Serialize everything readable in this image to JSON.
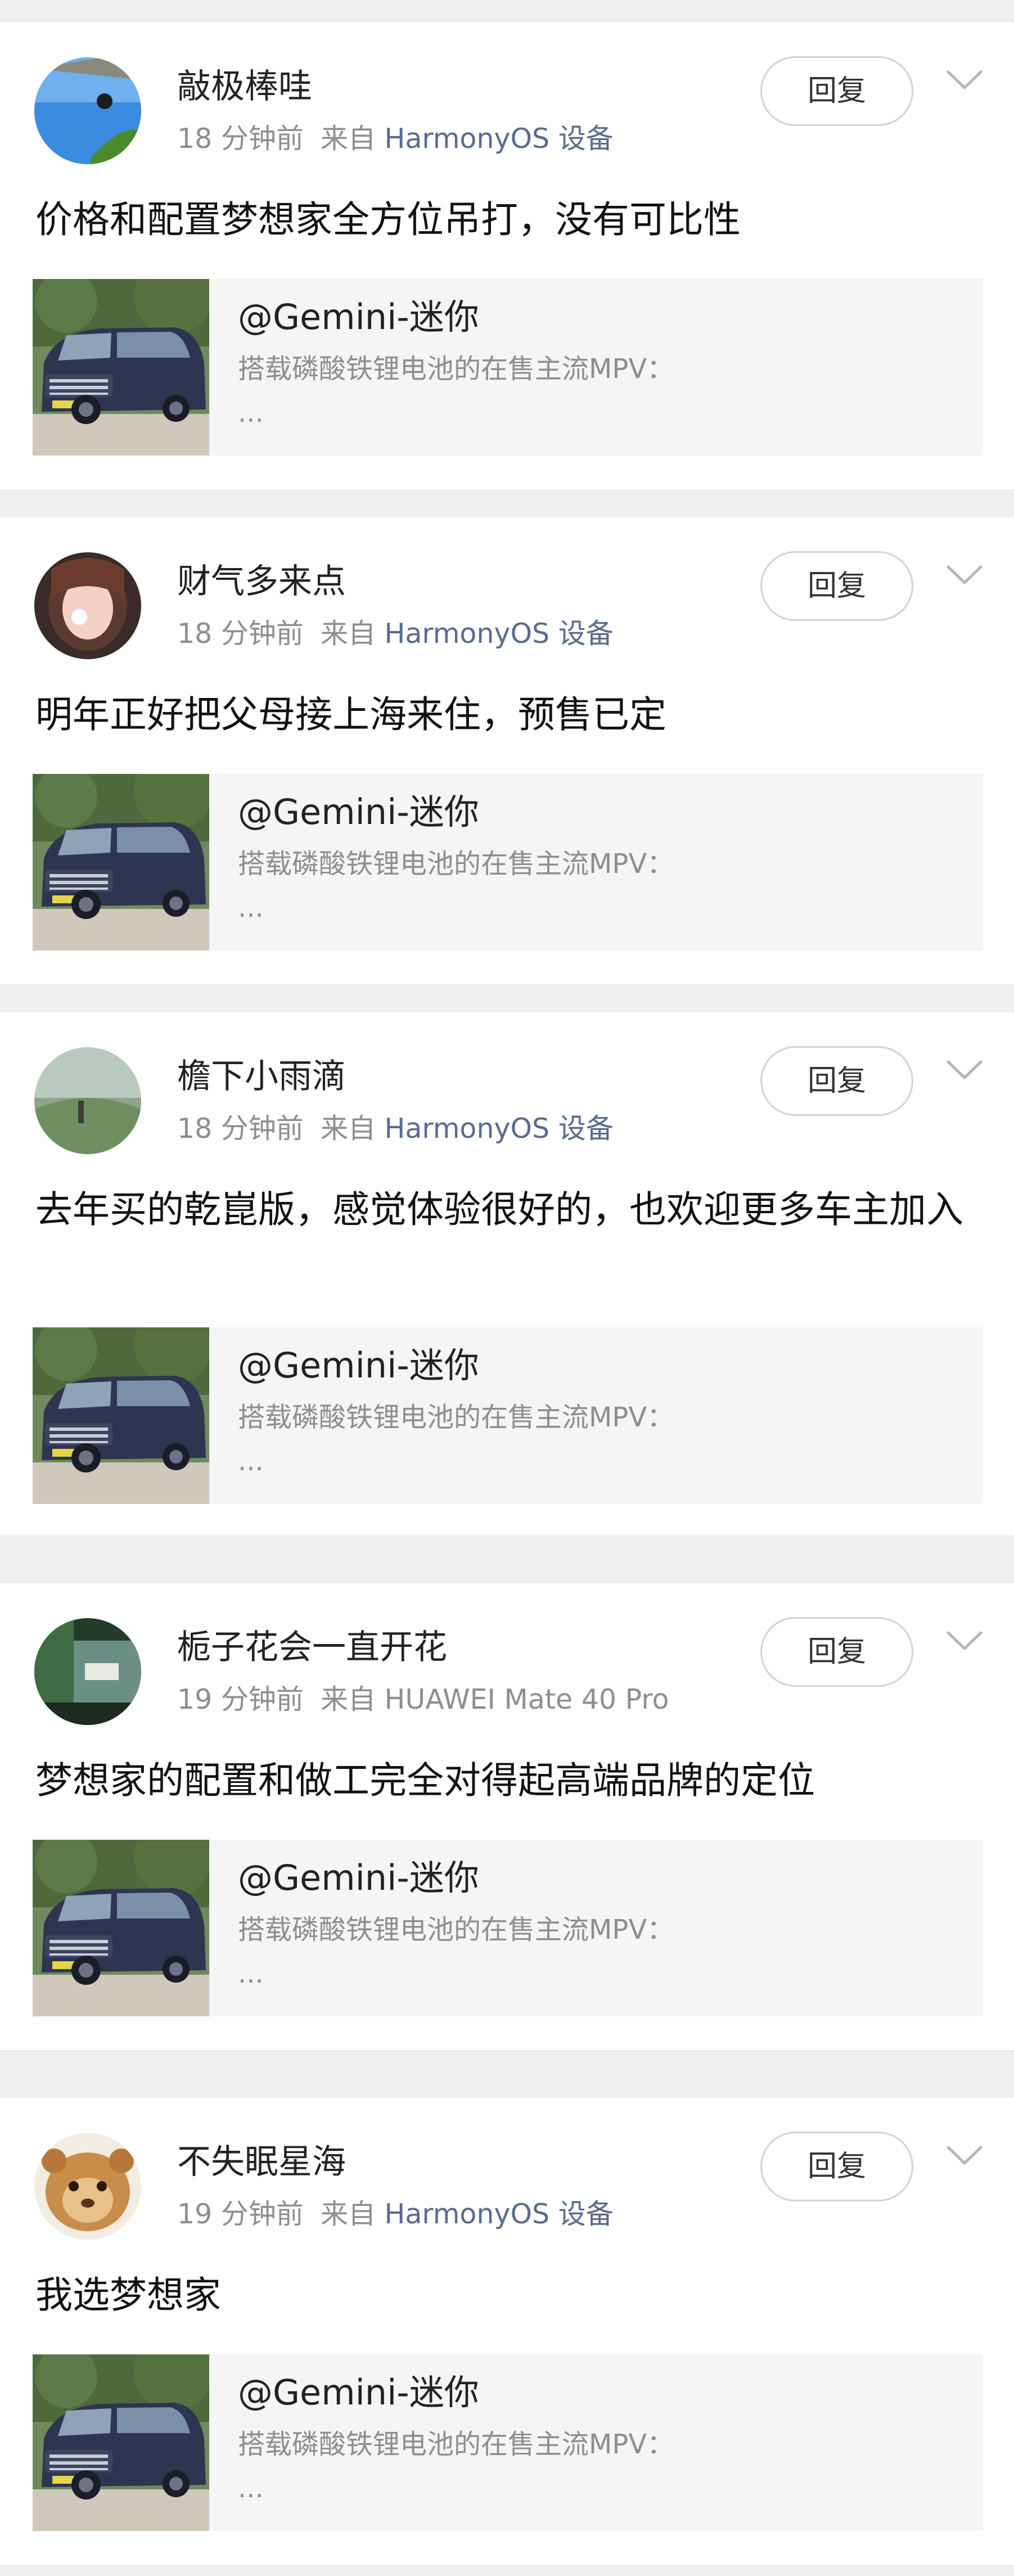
{
  "comments": [
    {
      "username": "敲极棒哇",
      "time": "18 分钟前",
      "source_prefix": "来自",
      "device": "HarmonyOS 设备",
      "reply_label": "回复",
      "text": "价格和配置梦想家全方位吊打，没有可比性",
      "quote": {
        "title": "@Gemini-迷你",
        "desc": "搭载磷酸铁锂电池的在售主流MPV：",
        "more": "..."
      }
    },
    {
      "username": "财气多来点",
      "time": "18 分钟前",
      "source_prefix": "来自",
      "device": "HarmonyOS 设备",
      "reply_label": "回复",
      "text": "明年正好把父母接上海来住，预售已定",
      "quote": {
        "title": "@Gemini-迷你",
        "desc": "搭载磷酸铁锂电池的在售主流MPV：",
        "more": "..."
      }
    },
    {
      "username": "檐下小雨滴",
      "time": "18 分钟前",
      "source_prefix": "来自",
      "device": "HarmonyOS 设备",
      "reply_label": "回复",
      "text": "去年买的乾崑版，感觉体验很好的，也欢迎更多车主加入",
      "quote": {
        "title": "@Gemini-迷你",
        "desc": "搭载磷酸铁锂电池的在售主流MPV：",
        "more": "..."
      }
    },
    {
      "username": "栀子花会一直开花",
      "time": "19 分钟前",
      "source_prefix": "来自",
      "device": "HUAWEI Mate 40 Pro",
      "reply_label": "回复",
      "text": "梦想家的配置和做工完全对得起高端品牌的定位",
      "quote": {
        "title": "@Gemini-迷你",
        "desc": "搭载磷酸铁锂电池的在售主流MPV：",
        "more": "..."
      }
    },
    {
      "username": "不失眠星海",
      "time": "19 分钟前",
      "source_prefix": "来自",
      "device": "HarmonyOS 设备",
      "reply_label": "回复",
      "text": "我选梦想家",
      "quote": {
        "title": "@Gemini-迷你",
        "desc": "搭载磷酸铁锂电池的在售主流MPV：",
        "more": "..."
      }
    }
  ],
  "colors": {
    "page_background": "#efefef",
    "card_background": "#ffffff",
    "link_device": "#5a6b8c",
    "meta_text": "#8e8e8e",
    "quote_background": "#f5f5f5"
  }
}
